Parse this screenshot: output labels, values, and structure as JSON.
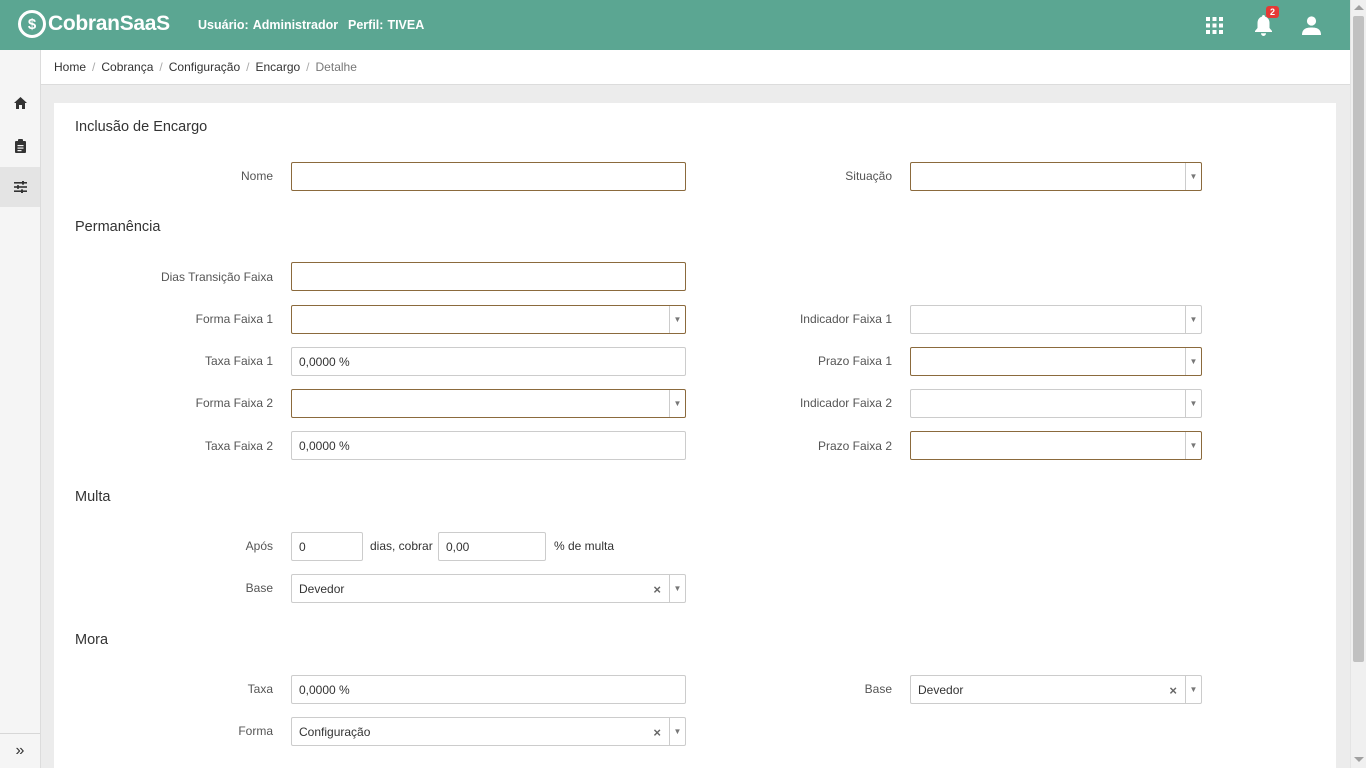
{
  "header": {
    "brand": "CobranSaaS",
    "user_label": "Usuário:",
    "user_value": "Administrador",
    "profile_label": "Perfil:",
    "profile_value": "TIVEA",
    "notifications_count": "2",
    "accent_color": "#5ba692"
  },
  "sidebar": {
    "items": [
      {
        "icon": "home-icon"
      },
      {
        "icon": "clipboard-icon"
      },
      {
        "icon": "sliders-icon"
      }
    ],
    "expand_glyph": "»"
  },
  "breadcrumb": {
    "items": [
      "Home",
      "Cobrança",
      "Configuração",
      "Encargo"
    ],
    "current": "Detalhe"
  },
  "form": {
    "title": "Inclusão de Encargo",
    "nome_label": "Nome",
    "nome_value": "",
    "situacao_label": "Situação",
    "situacao_value": "",
    "permanencia": {
      "title": "Permanência",
      "dias_label": "Dias Transição Faixa",
      "dias_value": "",
      "forma1_label": "Forma Faixa 1",
      "forma1_value": "",
      "indicador1_label": "Indicador Faixa 1",
      "indicador1_value": "",
      "taxa1_label": "Taxa Faixa 1",
      "taxa1_value": "0,0000 %",
      "prazo1_label": "Prazo Faixa 1",
      "prazo1_value": "",
      "forma2_label": "Forma Faixa 2",
      "forma2_value": "",
      "indicador2_label": "Indicador Faixa 2",
      "indicador2_value": "",
      "taxa2_label": "Taxa Faixa 2",
      "taxa2_value": "0,0000 %",
      "prazo2_label": "Prazo Faixa 2",
      "prazo2_value": ""
    },
    "multa": {
      "title": "Multa",
      "apos_label": "Após",
      "dias_value": "0",
      "dias_text": "dias, cobrar",
      "percent_value": "0,00",
      "percent_text": "% de multa",
      "base_label": "Base",
      "base_value": "Devedor"
    },
    "mora": {
      "title": "Mora",
      "taxa_label": "Taxa",
      "taxa_value": "0,0000 %",
      "base_label": "Base",
      "base_value": "Devedor",
      "forma_label": "Forma",
      "forma_value": "Configuração"
    }
  }
}
